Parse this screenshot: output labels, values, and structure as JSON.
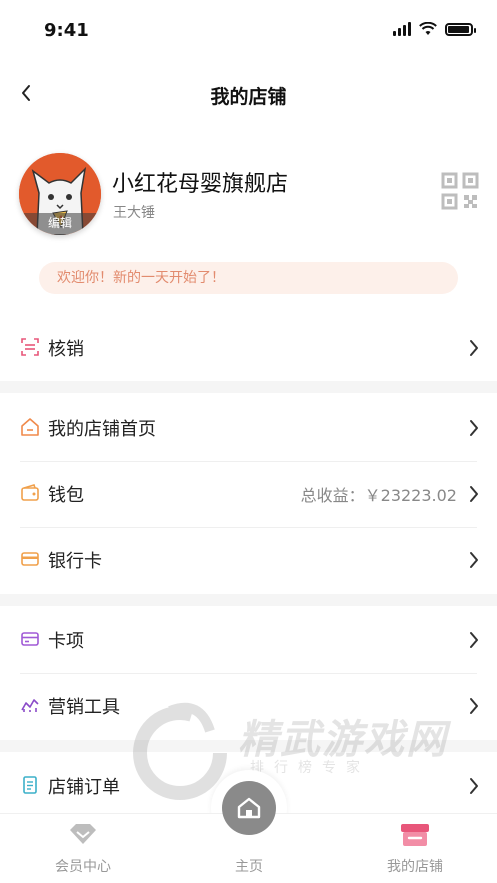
{
  "status_bar": {
    "time": "9:41"
  },
  "header": {
    "title": "我的店铺"
  },
  "profile": {
    "store_name": "小红花母婴旗舰店",
    "owner_name": "王大锤",
    "avatar_edit_label": "编辑"
  },
  "welcome_message": "欢迎你！新的一天开始了！",
  "menu": {
    "verify": {
      "label": "核销"
    },
    "store_home": {
      "label": "我的店铺首页"
    },
    "wallet": {
      "label": "钱包",
      "value": "总收益：￥23223.02"
    },
    "bank_card": {
      "label": "银行卡"
    },
    "card_items": {
      "label": "卡项"
    },
    "marketing": {
      "label": "营销工具"
    },
    "orders": {
      "label": "店铺订单"
    }
  },
  "watermark": {
    "title": "精武游戏网",
    "subtitle": "排行榜专家"
  },
  "tab_bar": {
    "member": "会员中心",
    "home": "主页",
    "my_store": "我的店铺"
  },
  "colors": {
    "accent_pink": "#e8567a",
    "avatar_bg": "#e25a2c",
    "welcome_bg": "#fdf0ea",
    "welcome_text": "#e28b6e"
  },
  "icons": {
    "back": "chevron-left-icon",
    "qr": "qr-code-icon",
    "verify": "scan-icon",
    "store_home": "home-outline-icon",
    "wallet": "wallet-icon",
    "bank_card": "credit-card-icon",
    "card_items": "card-icon",
    "marketing": "chart-icon",
    "orders": "document-icon",
    "member": "diamond-icon",
    "home": "home-icon",
    "my_store": "store-icon"
  }
}
